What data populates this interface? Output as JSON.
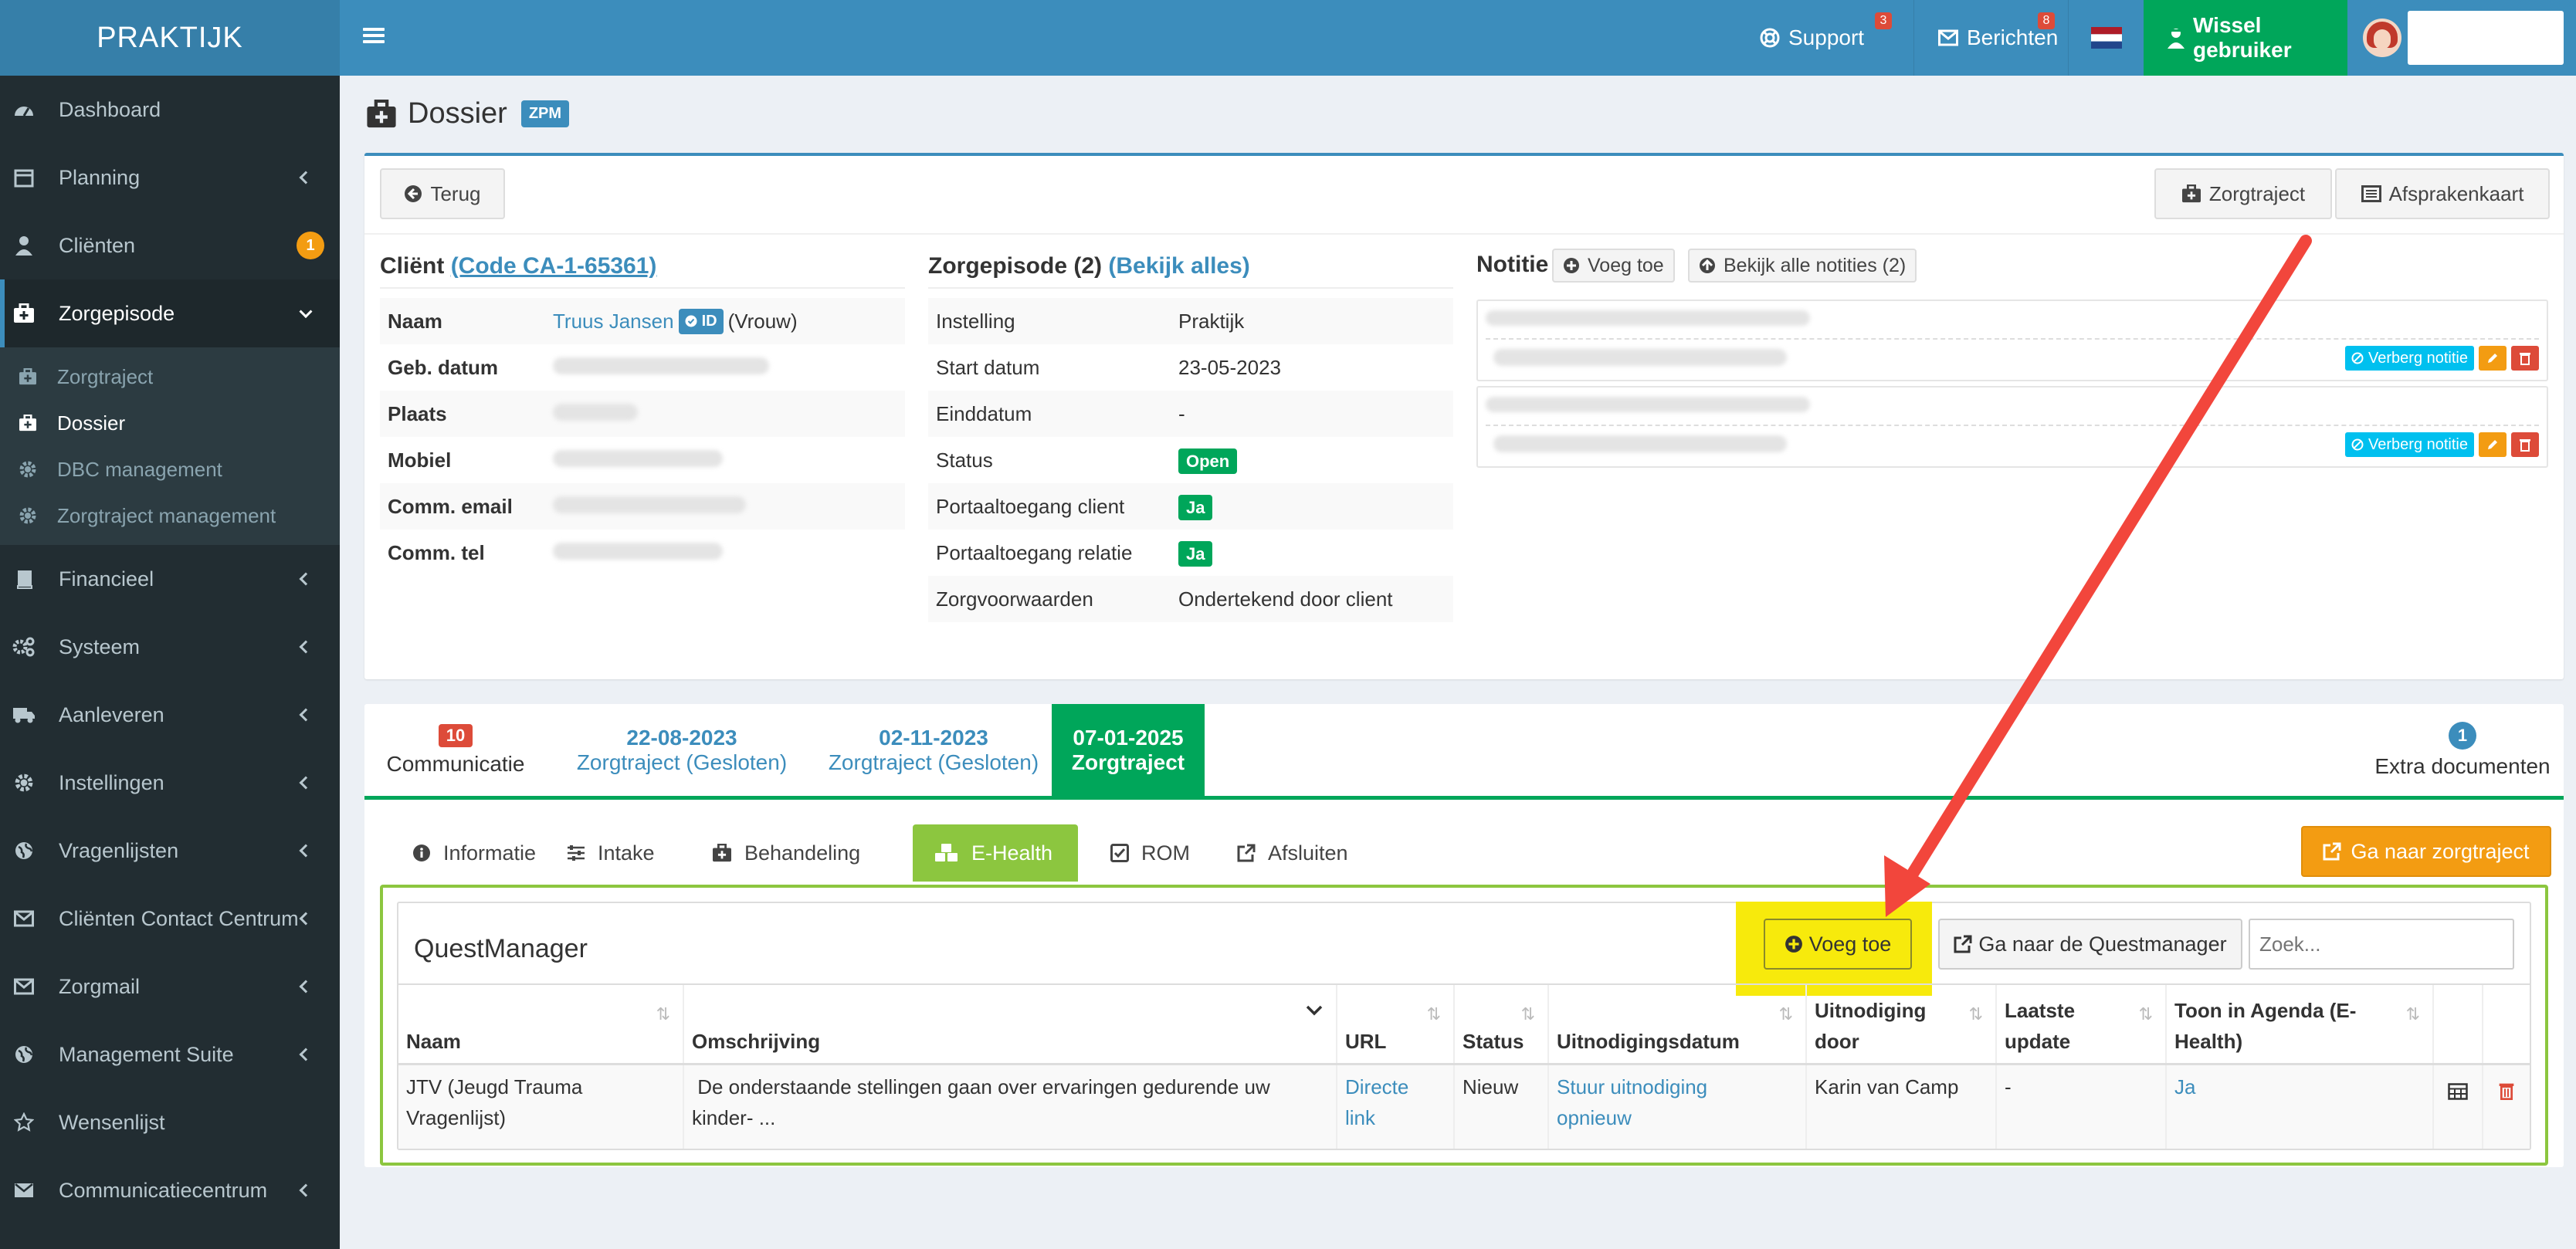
{
  "app": {
    "logo": "PRAKTIJK"
  },
  "topbar": {
    "support_label": "Support",
    "support_badge": "3",
    "messages_label": "Berichten",
    "messages_badge": "8",
    "switch_user_label": "Wissel gebruiker",
    "colors": {
      "bar": "#3c8dbc",
      "switch": "#00a65a"
    }
  },
  "sidebar": {
    "items": [
      {
        "label": "Dashboard",
        "icon": "dashboard-icon"
      },
      {
        "label": "Planning",
        "icon": "calendar-icon"
      },
      {
        "label": "Cliënten",
        "icon": "user-icon",
        "badge": "1"
      },
      {
        "label": "Zorgepisode",
        "icon": "medkit-icon"
      },
      {
        "label": "Financieel",
        "icon": "book-icon"
      },
      {
        "label": "Systeem",
        "icon": "cogs-icon"
      },
      {
        "label": "Aanleveren",
        "icon": "truck-icon"
      },
      {
        "label": "Instellingen",
        "icon": "gear-icon"
      },
      {
        "label": "Vragenlijsten",
        "icon": "globe-icon"
      },
      {
        "label": "Cliënten Contact Centrum",
        "icon": "envelope-icon"
      },
      {
        "label": "Zorgmail",
        "icon": "envelope-icon"
      },
      {
        "label": "Management Suite",
        "icon": "globe-icon"
      },
      {
        "label": "Wensenlijst",
        "icon": "star-icon"
      },
      {
        "label": "Communicatiecentrum",
        "icon": "envelope-icon"
      }
    ],
    "submenu": [
      {
        "label": "Zorgtraject"
      },
      {
        "label": "Dossier"
      },
      {
        "label": "DBC management"
      },
      {
        "label": "Zorgtraject management"
      }
    ]
  },
  "page": {
    "title": "Dossier",
    "badge": "ZPM",
    "back_label": "Terug",
    "zorgtraject_label": "Zorgtraject",
    "afsprakenkaart_label": "Afsprakenkaart"
  },
  "client": {
    "title_prefix": "Cliënt",
    "code_link": "(Code CA-1-65361)",
    "rows": {
      "naam_label": "Naam",
      "naam_value": "Truus Jansen",
      "id_badge": "ID",
      "gender": "(Vrouw)",
      "geb_label": "Geb. datum",
      "plaats_label": "Plaats",
      "mobiel_label": "Mobiel",
      "email_label": "Comm. email",
      "tel_label": "Comm. tel"
    }
  },
  "episode": {
    "title_prefix": "Zorgepisode (2)",
    "link": "(Bekijk alles)",
    "rows": [
      {
        "label": "Instelling",
        "value": "Praktijk"
      },
      {
        "label": "Start datum",
        "value": "23-05-2023"
      },
      {
        "label": "Einddatum",
        "value": "-"
      },
      {
        "label": "Status",
        "value": "Open"
      },
      {
        "label": "Portaaltoegang client",
        "value": "Ja"
      },
      {
        "label": "Portaaltoegang relatie",
        "value": "Ja"
      },
      {
        "label": "Zorgvoorwaarden",
        "value": "Ondertekend door client"
      }
    ]
  },
  "notes": {
    "title": "Notitie",
    "add_label": "Voeg toe",
    "view_all_label": "Bekijk alle notities (2)",
    "hide_label": "Verberg notitie"
  },
  "timeline": {
    "communicatie_count": "10",
    "communicatie_label": "Communicatie",
    "tabs": [
      {
        "date": "22-08-2023",
        "label": "Zorgtraject (Gesloten)"
      },
      {
        "date": "02-11-2023",
        "label": "Zorgtraject (Gesloten)"
      },
      {
        "date": "07-01-2025",
        "label": "Zorgtraject"
      }
    ],
    "extra_count": "1",
    "extra_label": "Extra documenten"
  },
  "subtabs": {
    "informatie": "Informatie",
    "intake": "Intake",
    "behandeling": "Behandeling",
    "ehealth": "E-Health",
    "rom": "ROM",
    "afsluiten": "Afsluiten",
    "goto_label": "Ga naar zorgtraject"
  },
  "questmanager": {
    "title": "QuestManager",
    "add_label": "Voeg toe",
    "goto_label": "Ga naar de Questmanager",
    "search_placeholder": "Zoek...",
    "columns": {
      "naam": "Naam",
      "omschrijving": "Omschrijving",
      "url": "URL",
      "status": "Status",
      "datum": "Uitnodigingsdatum",
      "door_1": "Uitnodiging",
      "door_2": "door",
      "update_1": "Laatste",
      "update_2": "update",
      "agenda_1": "Toon in Agenda (E-",
      "agenda_2": "Health)"
    },
    "rows": [
      {
        "naam_1": "JTV (Jeugd Trauma",
        "naam_2": "Vragenlijst)",
        "omschrijving_1": " De onderstaande stellingen gaan over ervaringen gedurende uw",
        "omschrijving_2": "kinder- ...",
        "url_1": "Directe",
        "url_2": "link",
        "status": "Nieuw",
        "datum_1": "Stuur uitnodiging",
        "datum_2": "opnieuw",
        "door": "Karin van Camp",
        "update": "-",
        "agenda": "Ja"
      }
    ]
  }
}
